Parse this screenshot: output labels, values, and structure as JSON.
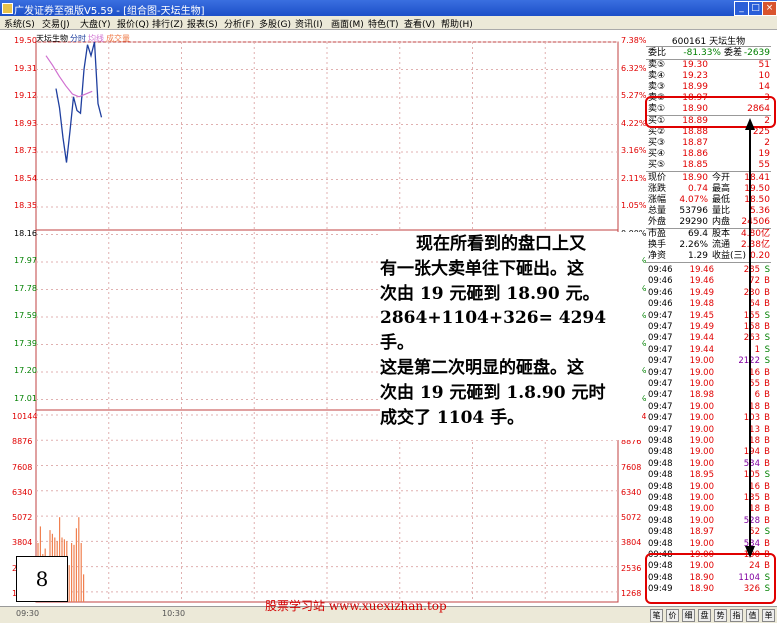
{
  "window": {
    "title": "广发证券至强版V5.59 - [组合图-天坛生物]"
  },
  "menu": [
    "系统(S)",
    "交易(J)",
    "大盘(Y)",
    "报价(Q)",
    "排行(Z)",
    "报表(S)",
    "分析(F)",
    "多股(G)",
    "资讯(I)",
    "画面(M)",
    "特色(T)",
    "查看(V)",
    "帮助(H)"
  ],
  "chart": {
    "legend": {
      "stock": "天坛生物",
      "tab1": "分时",
      "tab2": "均线",
      "tab3": "成交量"
    },
    "price_axis": [
      "19.50",
      "19.31",
      "19.12",
      "18.93",
      "18.73",
      "18.54",
      "18.35",
      "18.16",
      "17.97",
      "17.78",
      "17.59",
      "17.39",
      "17.20",
      "17.01"
    ],
    "pct_axis_top": [
      "7.38%",
      "6.32%",
      "5.27%",
      "4.22%",
      "3.16%",
      "2.11%",
      "1.05%",
      "0.00%"
    ],
    "pct_axis_bottom": [
      "2.11%",
      "3.16%",
      "4.22%",
      "5.27%",
      "6.32%",
      "7.38%"
    ],
    "volume_axis": [
      "10144",
      "8876",
      "7608",
      "6340",
      "5072",
      "3804",
      "2536",
      "1268"
    ],
    "time_axis": [
      "09:30",
      "10:30"
    ],
    "price_line": [
      19.16,
      19.02,
      18.8,
      18.62,
      18.85,
      19.1,
      19.0,
      18.98,
      19.3,
      19.48,
      19.4,
      19.5,
      19.05,
      18.95
    ],
    "avg_line": [
      19.4,
      19.33,
      19.25,
      19.18,
      19.12,
      19.1,
      19.12,
      19.14
    ],
    "volumes": [
      3200,
      4100,
      2600,
      2900,
      1800,
      3900,
      3700,
      3500,
      3300,
      4600,
      3500,
      3400,
      3300,
      2000,
      3200,
      3100,
      4000,
      4600,
      3200,
      1500
    ]
  },
  "quote": {
    "code": "600161",
    "name": "天坛生物",
    "weibi": {
      "label": "委比",
      "value": "-81.33%",
      "label2": "委差",
      "value2": "-2639"
    },
    "sells": [
      {
        "label": "卖⑤",
        "price": "19.30",
        "vol": "51"
      },
      {
        "label": "卖④",
        "price": "19.23",
        "vol": "10"
      },
      {
        "label": "卖③",
        "price": "18.99",
        "vol": "14"
      },
      {
        "label": "卖②",
        "price": "18.97",
        "vol": "3"
      },
      {
        "label": "卖①",
        "price": "18.90",
        "vol": "2864"
      }
    ],
    "buys": [
      {
        "label": "买①",
        "price": "18.89",
        "vol": "2"
      },
      {
        "label": "买②",
        "price": "18.88",
        "vol": "225"
      },
      {
        "label": "买③",
        "price": "18.87",
        "vol": "2"
      },
      {
        "label": "买④",
        "price": "18.86",
        "vol": "19"
      },
      {
        "label": "买⑤",
        "price": "18.85",
        "vol": "55"
      }
    ],
    "stats": [
      {
        "l1": "现价",
        "v1": "18.90",
        "l2": "今开",
        "v2": "18.41"
      },
      {
        "l1": "涨跌",
        "v1": "0.74",
        "l2": "最高",
        "v2": "19.50"
      },
      {
        "l1": "涨幅",
        "v1": "4.07%",
        "l2": "最低",
        "v2": "18.50"
      },
      {
        "l1": "总量",
        "v1": "53796",
        "l2": "量比",
        "v2": "5.36"
      },
      {
        "l1": "外盘",
        "v1": "29290",
        "l2": "内盘",
        "v2": "24506"
      },
      {
        "l1": "市盈",
        "v1": "69.4",
        "l2": "股本",
        "v2": "4.80亿"
      },
      {
        "l1": "换手",
        "v1": "2.26%",
        "l2": "流通",
        "v2": "2.38亿"
      },
      {
        "l1": "净资",
        "v1": "1.29",
        "l2": "收益(三)",
        "v2": "0.20"
      }
    ],
    "ticks": [
      [
        "09:46",
        "19.46",
        "285",
        "S"
      ],
      [
        "09:46",
        "19.46",
        "72",
        "B"
      ],
      [
        "09:46",
        "19.49",
        "230",
        "B"
      ],
      [
        "09:46",
        "19.48",
        "64",
        "B"
      ],
      [
        "09:47",
        "19.45",
        "155",
        "S"
      ],
      [
        "09:47",
        "19.49",
        "158",
        "B"
      ],
      [
        "09:47",
        "19.44",
        "263",
        "S"
      ],
      [
        "09:47",
        "19.44",
        "1",
        "S"
      ],
      [
        "09:47",
        "19.00",
        "2122",
        "S"
      ],
      [
        "09:47",
        "19.00",
        "16",
        "B"
      ],
      [
        "09:47",
        "19.00",
        "55",
        "B"
      ],
      [
        "09:47",
        "18.98",
        "6",
        "B"
      ],
      [
        "09:47",
        "19.00",
        "18",
        "B"
      ],
      [
        "09:47",
        "19.00",
        "103",
        "B"
      ],
      [
        "09:47",
        "19.00",
        "13",
        "B"
      ],
      [
        "09:48",
        "19.00",
        "18",
        "B"
      ],
      [
        "09:48",
        "19.00",
        "194",
        "B"
      ],
      [
        "09:48",
        "19.00",
        "534",
        "B"
      ],
      [
        "09:48",
        "18.95",
        "105",
        "S"
      ],
      [
        "09:48",
        "19.00",
        "16",
        "B"
      ],
      [
        "09:48",
        "19.00",
        "135",
        "B"
      ],
      [
        "09:48",
        "19.00",
        "18",
        "B"
      ],
      [
        "09:48",
        "19.00",
        "528",
        "B"
      ],
      [
        "09:48",
        "18.97",
        "52",
        "S"
      ],
      [
        "09:48",
        "19.00",
        "534",
        "B"
      ],
      [
        "09:48",
        "19.00",
        "190",
        "B"
      ],
      [
        "09:48",
        "19.00",
        "24",
        "B"
      ],
      [
        "09:48",
        "18.90",
        "1104",
        "S"
      ],
      [
        "09:49",
        "18.90",
        "326",
        "S"
      ]
    ],
    "bottom_tabs": [
      "笔",
      "价",
      "细",
      "盘",
      "势",
      "指",
      "值",
      "单"
    ]
  },
  "annotation": {
    "lines": [
      "现在所看到的盘口上又",
      "有一张大卖单往下砸出。这",
      "次由 19 元砸到 18.90 元。",
      "2864+1104+326= 4294 手。",
      "这是第二次明显的砸盘。这",
      "次由 19 元砸到 1.8.90 元时",
      "成交了 1104 手。"
    ]
  },
  "badge": "8",
  "footer": {
    "site": "股票学习站  www.xuexizhan.top"
  },
  "colors": {
    "up": "#e00000",
    "down": "#008000",
    "price_line": "#1f3f9f",
    "avg_line": "#d070d0",
    "volume": "#f08050",
    "annot_box": "#e00000"
  }
}
